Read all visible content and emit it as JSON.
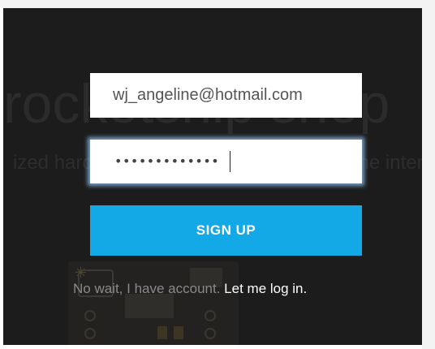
{
  "signup_form": {
    "email": {
      "value": "wj_angeline@hotmail.com"
    },
    "password": {
      "masked_value": "•••••••••••••"
    },
    "submit_label": "SIGN UP",
    "login_prompt": {
      "text": "No wait, I have account.",
      "link_text": "Let me log in."
    }
  },
  "colors": {
    "overlay": "#1c1c1c",
    "button": "#13a8e6",
    "focus_glow": "#96cdff"
  }
}
